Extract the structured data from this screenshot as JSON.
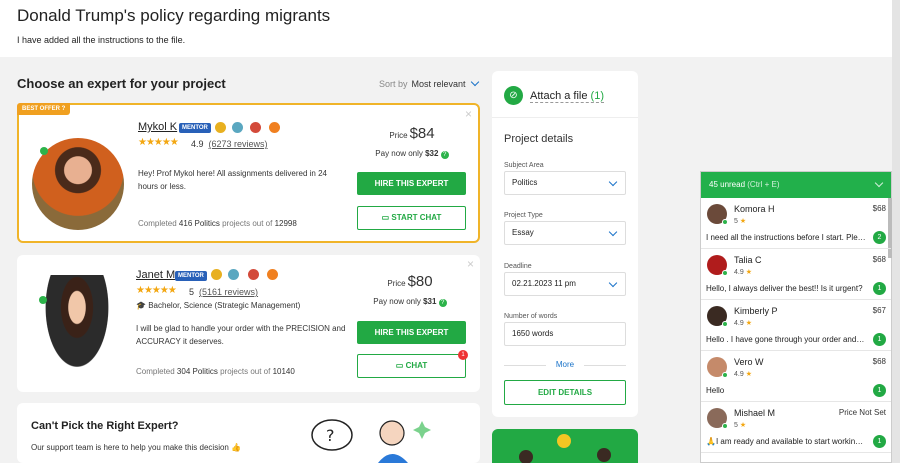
{
  "header": {
    "title": "Donald Trump's policy regarding migrants",
    "subtitle": "I have added all the instructions to the file."
  },
  "list": {
    "heading": "Choose an expert for your project",
    "sort_label": "Sort by",
    "sort_value": "Most relevant"
  },
  "experts": [
    {
      "badge": "BEST OFFER",
      "name": "Mykol K",
      "mentor": "MENTOR",
      "rating": "4.9",
      "reviews": "(6273 reviews)",
      "description": "Hey! Prof Mykol here! All assignments delivered in 24 hours or less.",
      "completed_prefix": "Completed",
      "completed_count": "416",
      "completed_subject": "Politics",
      "completed_mid": "projects out of",
      "completed_total": "12998",
      "price_label": "Price",
      "price": "$84",
      "paynow_label": "Pay now only",
      "paynow": "$32",
      "hire": "HIRE THIS EXPERT",
      "chat": "START CHAT"
    },
    {
      "name": "Janet M",
      "mentor": "MENTOR",
      "rating": "5",
      "reviews": "(5161 reviews)",
      "education": "Bachelor, Science (Strategic Management)",
      "description": "I will be glad to handle your order with the PRECISION and ACCURACY it deserves.",
      "completed_prefix": "Completed",
      "completed_count": "304",
      "completed_subject": "Politics",
      "completed_mid": "projects out of",
      "completed_total": "10140",
      "price_label": "Price",
      "price": "$80",
      "paynow_label": "Pay now only",
      "paynow": "$31",
      "hire": "HIRE THIS EXPERT",
      "chat": "CHAT",
      "chat_badge": "1"
    }
  ],
  "help": {
    "title": "Can't Pick the Right Expert?",
    "text": "Our support team is here to help you make this decision 👍"
  },
  "sidebar": {
    "attach_label": "Attach a file",
    "attach_count": "(1)",
    "details_title": "Project details",
    "subject_label": "Subject Area",
    "subject_value": "Politics",
    "type_label": "Project Type",
    "type_value": "Essay",
    "deadline_label": "Deadline",
    "deadline_value": "02.21.2023 11 pm",
    "words_label": "Number of words",
    "words_value": "1650 words",
    "more": "More",
    "edit": "EDIT DETAILS"
  },
  "chat": {
    "unread": "45 unread",
    "shortcut": "(Ctrl + E)",
    "items": [
      {
        "name": "Komora H",
        "rating": "5",
        "price": "$68",
        "message": "I need all the instructions before I start. Pleas...",
        "count": "2"
      },
      {
        "name": "Talia C",
        "rating": "4.9",
        "price": "$68",
        "message": "Hello, I always deliver the best!! Is it urgent?",
        "count": "1"
      },
      {
        "name": "Kimberly P",
        "rating": "4.9",
        "price": "$67",
        "message": "Hello . I have gone through your order and I ...",
        "count": "1"
      },
      {
        "name": "Vero W",
        "rating": "4.9",
        "price": "$68",
        "message": "Hello",
        "count": "1"
      },
      {
        "name": "Mishael M",
        "rating": "5",
        "price": "Price Not Set",
        "message": "🙏I am ready and available to start working ...",
        "count": "1"
      }
    ]
  }
}
